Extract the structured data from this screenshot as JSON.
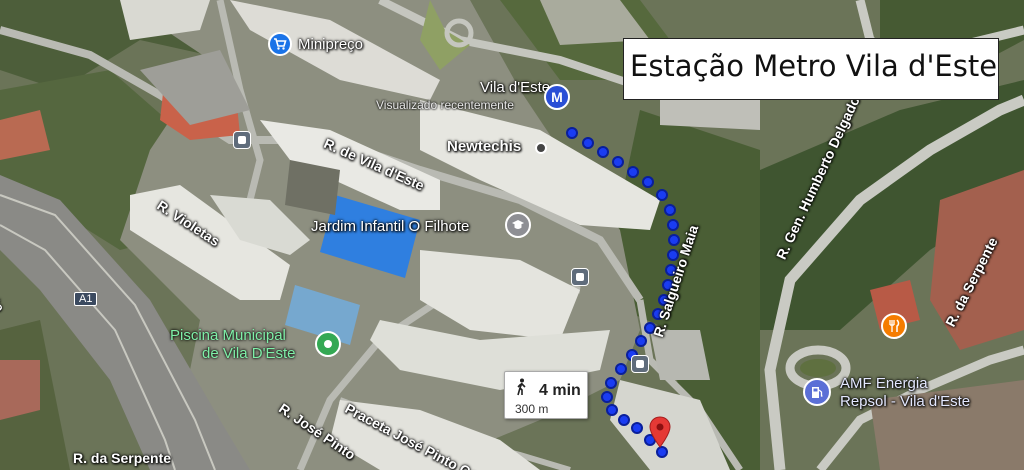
{
  "title": "Estação Metro Vila d'Este",
  "pois": {
    "minipreco": "Minipreço",
    "metro_station": "Vila d'Este",
    "metro_sub": "Visualizado recentemente",
    "metro_icon": "M",
    "newtechis": "Newtechis",
    "jardim": "Jardim Infantil O Filhote",
    "piscina_line1": "Piscina Municipal",
    "piscina_line2": "de Vila D'Este",
    "amf_line1": "AMF Energia",
    "amf_line2": "Repsol - Vila d'Este"
  },
  "streets": {
    "vila_deste": "R. de Vila d'Este",
    "violetas": "R. Violetas",
    "salgueiro": "R. Salgueiro Maia",
    "humberto": "R. Gen. Humberto Delgado",
    "serpente_right": "R. da Serpente",
    "serpente_bottom": "R. da Serpente",
    "serpente_left": "Serpente",
    "jose_pinto": "R. José Pinto",
    "praceta": "Praceta José Pinto Corr",
    "highway": "A1"
  },
  "route": {
    "walk_icon": "walking-person-icon",
    "time": "4 min",
    "distance": "300 m",
    "color": "#1a3cf2"
  },
  "colors": {
    "destination_pin": "#e53935",
    "park_green": "#34a853",
    "shopping_blue": "#1a73e8",
    "food_orange": "#f57c00",
    "fuel_blue": "#5b6fd6"
  }
}
